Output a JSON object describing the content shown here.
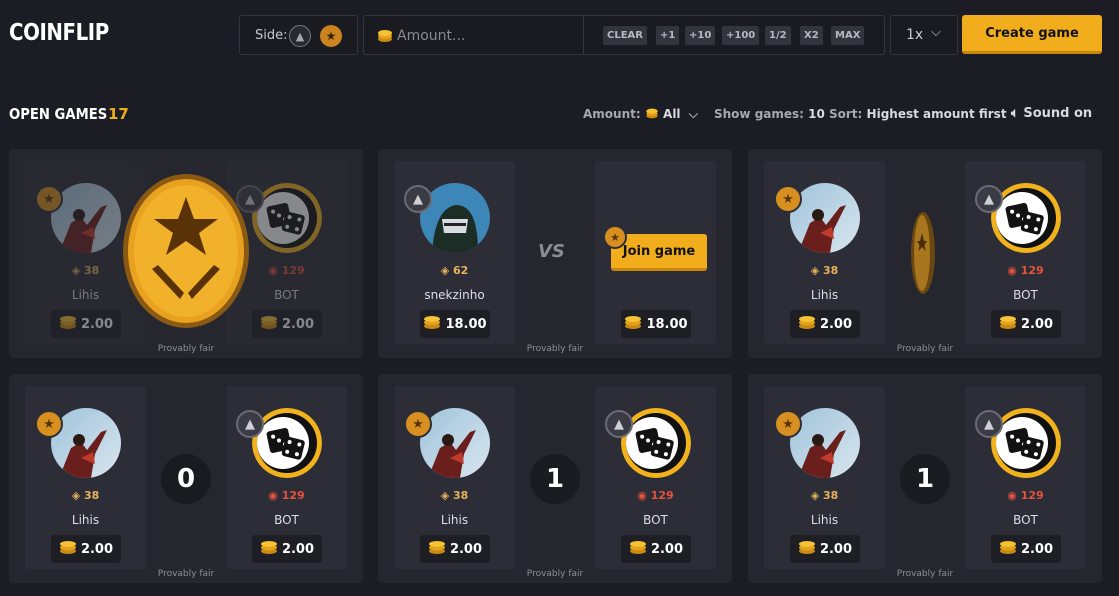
{
  "header": {
    "title": "COINFLIP",
    "side_label": "Side:",
    "amount_placeholder": "Amount...",
    "chips": [
      "CLEAR",
      "+1",
      "+10",
      "+100",
      "1/2",
      "X2",
      "MAX"
    ],
    "multiplier": "1x",
    "create_button": "Create game"
  },
  "open_games": {
    "title": "OPEN GAMES",
    "count": "17",
    "amount_label": "Amount:",
    "amount_value": "All",
    "show_label": "Show games:",
    "show_value": "10",
    "sort_label": "Sort:",
    "sort_value": "Highest amount first",
    "sound": "Sound on"
  },
  "colors": {
    "accent": "#f1ad1b",
    "bg": "#1c1d24",
    "card": "#25262e",
    "panel": "#2c2d36"
  },
  "provably_fair": "Provably fair",
  "vs_label": "VS",
  "join_label": "Join game",
  "games": [
    {
      "state": "flipping",
      "left": {
        "name": "Lihis",
        "level": "38",
        "bet": "2.00",
        "side": "t"
      },
      "right": {
        "name": "BOT",
        "level": "129",
        "bet": "2.00",
        "side": "ct"
      }
    },
    {
      "state": "waiting",
      "left": {
        "name": "snekzinho",
        "level": "62",
        "bet": "18.00",
        "side": "ct"
      },
      "right": {
        "bet": "18.00",
        "side": "t"
      }
    },
    {
      "state": "spinning",
      "left": {
        "name": "Lihis",
        "level": "38",
        "bet": "2.00",
        "side": "t"
      },
      "right": {
        "name": "BOT",
        "level": "129",
        "bet": "2.00",
        "side": "ct"
      }
    },
    {
      "state": "countdown",
      "countdown": "0",
      "left": {
        "name": "Lihis",
        "level": "38",
        "bet": "2.00",
        "side": "t"
      },
      "right": {
        "name": "BOT",
        "level": "129",
        "bet": "2.00",
        "side": "ct"
      }
    },
    {
      "state": "countdown",
      "countdown": "1",
      "left": {
        "name": "Lihis",
        "level": "38",
        "bet": "2.00",
        "side": "t"
      },
      "right": {
        "name": "BOT",
        "level": "129",
        "bet": "2.00",
        "side": "ct"
      }
    },
    {
      "state": "countdown",
      "countdown": "1",
      "left": {
        "name": "Lihis",
        "level": "38",
        "bet": "2.00",
        "side": "t"
      },
      "right": {
        "name": "BOT",
        "level": "129",
        "bet": "2.00",
        "side": "ct"
      }
    }
  ]
}
